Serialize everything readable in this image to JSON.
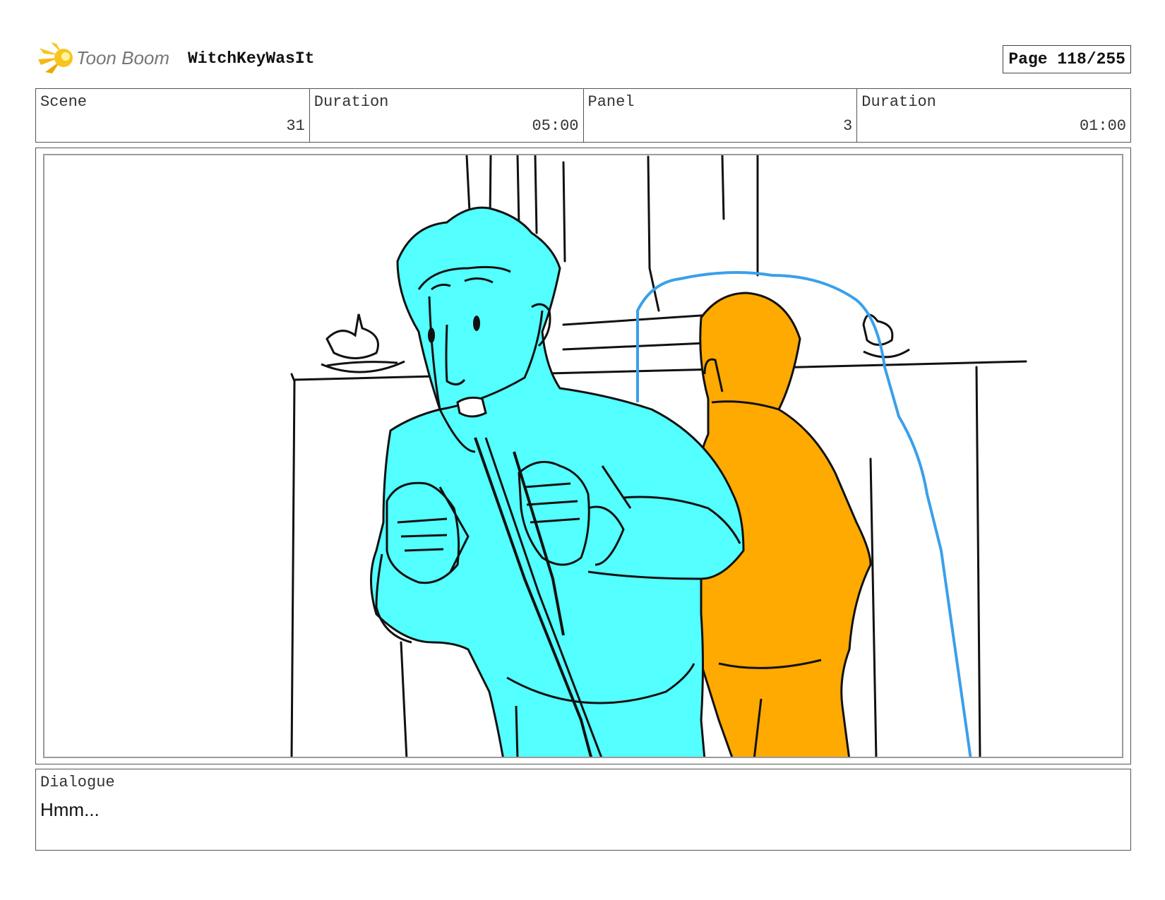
{
  "header": {
    "logo_text": "Toon Boom",
    "project_title": "WitchKeyWasIt",
    "page_label": "Page 118/255"
  },
  "info": {
    "scene_label": "Scene",
    "scene_value": "31",
    "scene_duration_label": "Duration",
    "scene_duration_value": "05:00",
    "panel_label": "Panel",
    "panel_value": "3",
    "panel_duration_label": "Duration",
    "panel_duration_value": "01:00"
  },
  "dialogue": {
    "label": "Dialogue",
    "text": "Hmm..."
  },
  "colors": {
    "boy_fill": "#54ffff",
    "kid_fill": "#ffaa00",
    "ghost_outline": "#3aa0ea",
    "ink": "#111111",
    "logo_yellow": "#f7c51e",
    "logo_text": "#777777"
  }
}
